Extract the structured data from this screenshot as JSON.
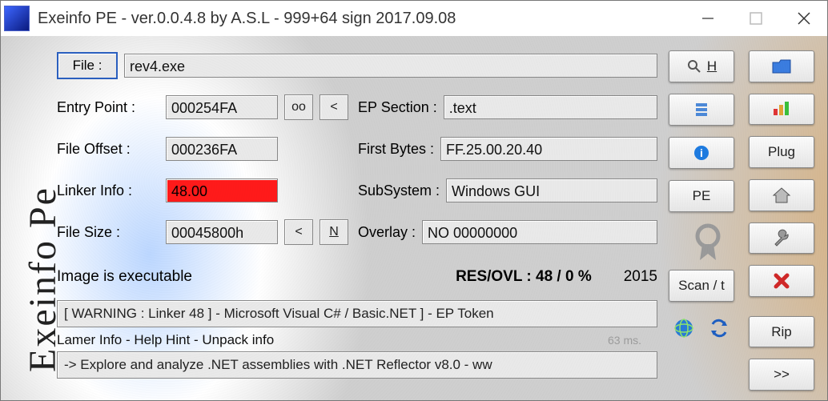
{
  "title": "Exeinfo PE - ver.0.0.4.8  by A.S.L -  999+64 sign  2017.09.08",
  "side_logo_text": "Exeinfo Pe",
  "labels": {
    "file_btn": "File :",
    "entry_point": "Entry Point :",
    "file_offset": "File Offset :",
    "linker_info": "Linker Info :",
    "file_size": "File Size :",
    "ep_section": "EP Section :",
    "first_bytes": "First Bytes :",
    "subsystem": "SubSystem :",
    "overlay": "Overlay :",
    "pe_btn": "PE",
    "scan_btn": "Scan / t",
    "rip_btn": "Rip",
    "plug_btn": "Plug",
    "fwd_btn": ">>",
    "oo_btn": "oo",
    "lt_btn": "<",
    "lt2_btn": "<",
    "n_btn": "N",
    "h_btn": "H"
  },
  "fields": {
    "file": "rev4.exe",
    "entry_point": "000254FA",
    "file_offset": "000236FA",
    "linker_info": "48.00",
    "file_size": "00045800h",
    "ep_section": ".text",
    "first_bytes": "FF.25.00.20.40",
    "subsystem": "Windows GUI",
    "overlay": "NO   00000000"
  },
  "status": {
    "exec": "Image is executable",
    "res_label": "RES/OVL : 48 / 0 %",
    "year": "2015"
  },
  "warning": "[ WARNING : Linker 48 ] - Microsoft Visual C# / Basic.NET ]  - EP Token",
  "lamer": "Lamer Info - Help Hint - Unpack info",
  "timing": "63 ms.",
  "hint": "-> Explore and analyze .NET assemblies with .NET Reflector v8.0 - ww"
}
